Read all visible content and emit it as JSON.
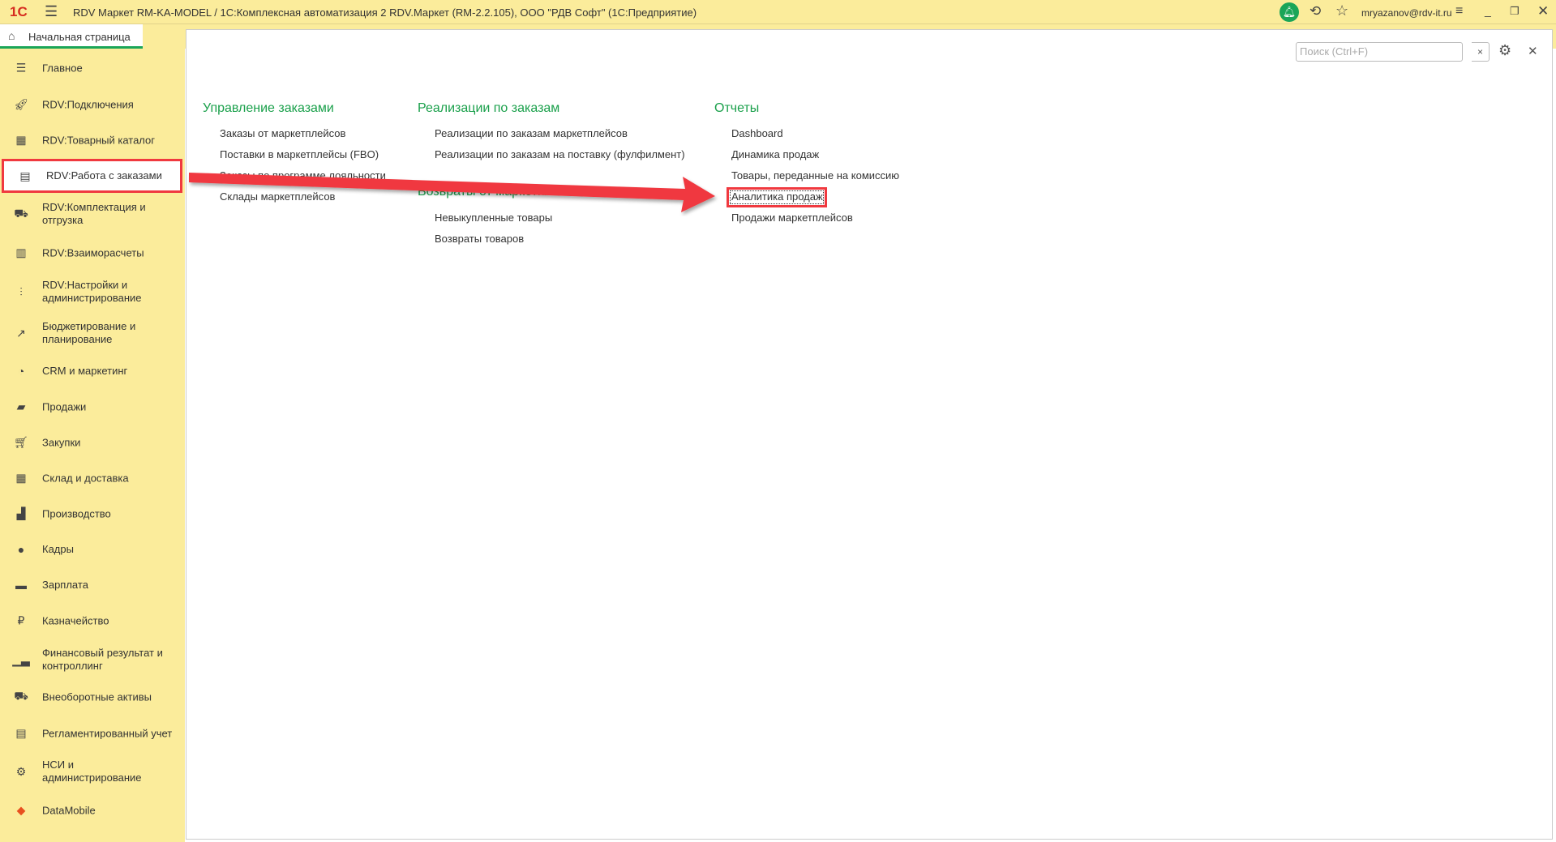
{
  "titlebar": {
    "title": "RDV Маркет RM-KA-MODEL / 1С:Комплексная автоматизация 2 RDV.Маркет (RM-2.2.105), ООО \"РДВ Софт\"  (1С:Предприятие)",
    "logo": "1С",
    "user": "mryazanov@rdv-it.ru"
  },
  "tabs": {
    "home": "Начальная страница"
  },
  "sidebar": {
    "items": [
      {
        "label": "Главное",
        "icon": "list-icon"
      },
      {
        "label": "RDV:Подключения",
        "icon": "rocket-icon"
      },
      {
        "label": "RDV:Товарный каталог",
        "icon": "grid-icon"
      },
      {
        "label": "RDV:Работа с заказами",
        "icon": "orders-icon"
      },
      {
        "label": "RDV:Комплектация и отгрузка",
        "icon": "cart-box-icon"
      },
      {
        "label": "RDV:Взаиморасчеты",
        "icon": "calculator-icon"
      },
      {
        "label": "RDV:Настройки и администрирование",
        "icon": "sliders-icon"
      },
      {
        "label": "Бюджетирование и планирование",
        "icon": "budget-icon"
      },
      {
        "label": "CRM и маркетинг",
        "icon": "pie-icon"
      },
      {
        "label": "Продажи",
        "icon": "bag-icon"
      },
      {
        "label": "Закупки",
        "icon": "cart-icon"
      },
      {
        "label": "Склад и доставка",
        "icon": "warehouse-icon"
      },
      {
        "label": "Производство",
        "icon": "factory-icon"
      },
      {
        "label": "Кадры",
        "icon": "person-icon"
      },
      {
        "label": "Зарплата",
        "icon": "card-icon"
      },
      {
        "label": "Казначейство",
        "icon": "ruble-icon"
      },
      {
        "label": "Финансовый результат и контроллинг",
        "icon": "bar-chart-icon"
      },
      {
        "label": "Внеоборотные активы",
        "icon": "truck-icon"
      },
      {
        "label": "Регламентированный учет",
        "icon": "ledger-icon"
      },
      {
        "label": "НСИ и администрирование",
        "icon": "gear-icon"
      },
      {
        "label": "DataMobile",
        "icon": "datamobile-icon"
      }
    ]
  },
  "search": {
    "placeholder": "Поиск (Ctrl+F)",
    "clear": "×"
  },
  "panel": {
    "groups": [
      {
        "heading": "Управление заказами",
        "items": [
          "Заказы от маркетплейсов",
          "Поставки в маркетплейсы (FBO)",
          "Заказы по программе лояльности",
          "Склады маркетплейсов"
        ]
      },
      {
        "heading": "Реализации по заказам",
        "items": [
          "Реализации по заказам маркетплейсов",
          "Реализации по заказам на поставку (фулфилмент)"
        ]
      },
      {
        "heading": "Возвраты от маркетплейсов",
        "items": [
          "Невыкупленные товары",
          "Возвраты товаров"
        ]
      },
      {
        "heading": "Отчеты",
        "items": [
          "Dashboard",
          "Динамика продаж",
          "Товары, переданные на комиссию",
          "Аналитика продаж",
          "Продажи маркетплейсов"
        ]
      }
    ]
  },
  "colors": {
    "accent": "#1aa04b",
    "sidebar": "#fbec9b",
    "highlight": "#f0393f"
  }
}
